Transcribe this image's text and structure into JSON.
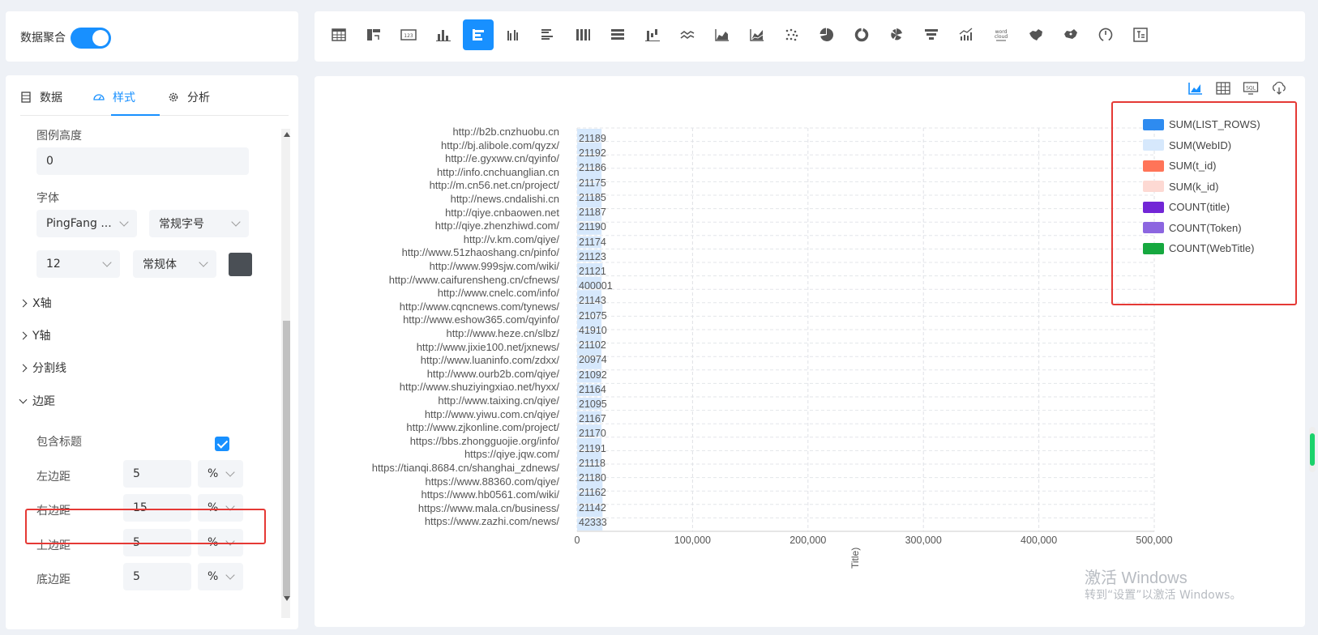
{
  "aggregation": {
    "label": "数据聚合",
    "enabled": true
  },
  "tabs": [
    {
      "label": "数据",
      "icon": "table-icon"
    },
    {
      "label": "样式",
      "icon": "palette-icon",
      "active": true
    },
    {
      "label": "分析",
      "icon": "gear-icon"
    }
  ],
  "style": {
    "legend_height_label": "图例高度",
    "legend_height_value": "0",
    "font_label": "字体",
    "font_family": "PingFang ...",
    "font_size_preset": "常规字号",
    "font_size": "12",
    "font_weight": "常规体",
    "font_color": "#4a4f55"
  },
  "sections": {
    "x_axis": "X轴",
    "y_axis": "Y轴",
    "split_line": "分割线",
    "margin": "边距"
  },
  "margin": {
    "include_title_label": "包含标题",
    "include_title": true,
    "rows": [
      {
        "label": "左边距",
        "value": "5",
        "unit": "%"
      },
      {
        "label": "右边距",
        "value": "15",
        "unit": "%"
      },
      {
        "label": "上边距",
        "value": "5",
        "unit": "%"
      },
      {
        "label": "底边距",
        "value": "5",
        "unit": "%"
      }
    ]
  },
  "toolbar": {
    "icons": [
      "table-icon",
      "pivot-table-icon",
      "number-card-icon",
      "column-chart-icon",
      "bar-chart-icon",
      "grouped-column-icon",
      "grouped-bar-icon",
      "stacked-column-icon",
      "stacked-bar-icon",
      "waterfall-icon",
      "line-chart-icon",
      "area-chart-icon",
      "stacked-area-icon",
      "scatter-icon",
      "pie-chart-icon",
      "donut-chart-icon",
      "rose-chart-icon",
      "funnel-icon",
      "combo-chart-icon",
      "word-cloud-icon",
      "map-icon",
      "heat-map-icon",
      "gauge-icon",
      "text-icon"
    ],
    "active": "bar-chart-icon",
    "word_cloud_text": "word cloud"
  },
  "chart_tools": [
    "chart-view-icon",
    "table-view-icon",
    "sql-icon",
    "download-icon"
  ],
  "chart_data": {
    "type": "bar",
    "orientation": "horizontal",
    "categories": [
      "http://b2b.cnzhuobu.cn",
      "http://bj.alibole.com/qyzx/",
      "http://e.gyxww.cn/qyinfo/",
      "http://info.cnchuanglian.cn",
      "http://m.cn56.net.cn/project/",
      "http://news.cndalishi.cn",
      "http://qiye.cnbaowen.net",
      "http://qiye.zhenzhiwd.com/",
      "http://v.km.com/qiye/",
      "http://www.51zhaoshang.cn/pinfo/",
      "http://www.999sjw.com/wiki/",
      "http://www.caifurensheng.cn/cfnews/",
      "http://www.cnelc.com/info/",
      "http://www.cqncnews.com/tynews/",
      "http://www.eshow365.com/qyinfo/",
      "http://www.heze.cn/slbz/",
      "http://www.jixie100.net/jxnews/",
      "http://www.luaninfo.com/zdxx/",
      "http://www.ourb2b.com/qiye/",
      "http://www.shuziyingxiao.net/hyxx/",
      "http://www.taixing.cn/qiye/",
      "http://www.yiwu.com.cn/qiye/",
      "http://www.zjkonline.com/project/",
      "https://bbs.zhongguojie.org/info/",
      "https://qiye.jqw.com/",
      "https://tianqi.8684.cn/shanghai_zdnews/",
      "https://www.88360.com/qiye/",
      "https://www.hb0561.com/wiki/",
      "https://www.mala.cn/business/",
      "https://www.zazhi.com/news/"
    ],
    "data_labels": [
      "21189",
      "21192",
      "21186",
      "21175",
      "21185",
      "21187",
      "21190",
      "21174",
      "21123",
      "21121",
      "400001",
      "21143",
      "21075",
      "41910",
      "21102",
      "20974",
      "21092",
      "21164",
      "21095",
      "21167",
      "21170",
      "21191",
      "21118",
      "21180",
      "21162",
      "21142",
      "42333"
    ],
    "series": [
      {
        "name": "SUM(LIST_ROWS)",
        "color": "#2e8bf0"
      },
      {
        "name": "SUM(WebID)",
        "color": "#d6e8fc"
      },
      {
        "name": "SUM(t_id)",
        "color": "#ff7458"
      },
      {
        "name": "SUM(k_id)",
        "color": "#fdd9d3"
      },
      {
        "name": "COUNT(title)",
        "color": "#7226d6"
      },
      {
        "name": "COUNT(Token)",
        "color": "#8c66e0"
      },
      {
        "name": "COUNT(WebTitle)",
        "color": "#16a83f"
      }
    ],
    "x_ticks": [
      "0",
      "100,000",
      "200,000",
      "300,000",
      "400,000",
      "500,000"
    ],
    "xlim": [
      0,
      500000
    ],
    "xlabel": "Title)",
    "grid": true,
    "legend_position": "top-right"
  },
  "watermark": {
    "line1": "激活 Windows",
    "line2": "转到“设置”以激活 Windows。"
  }
}
